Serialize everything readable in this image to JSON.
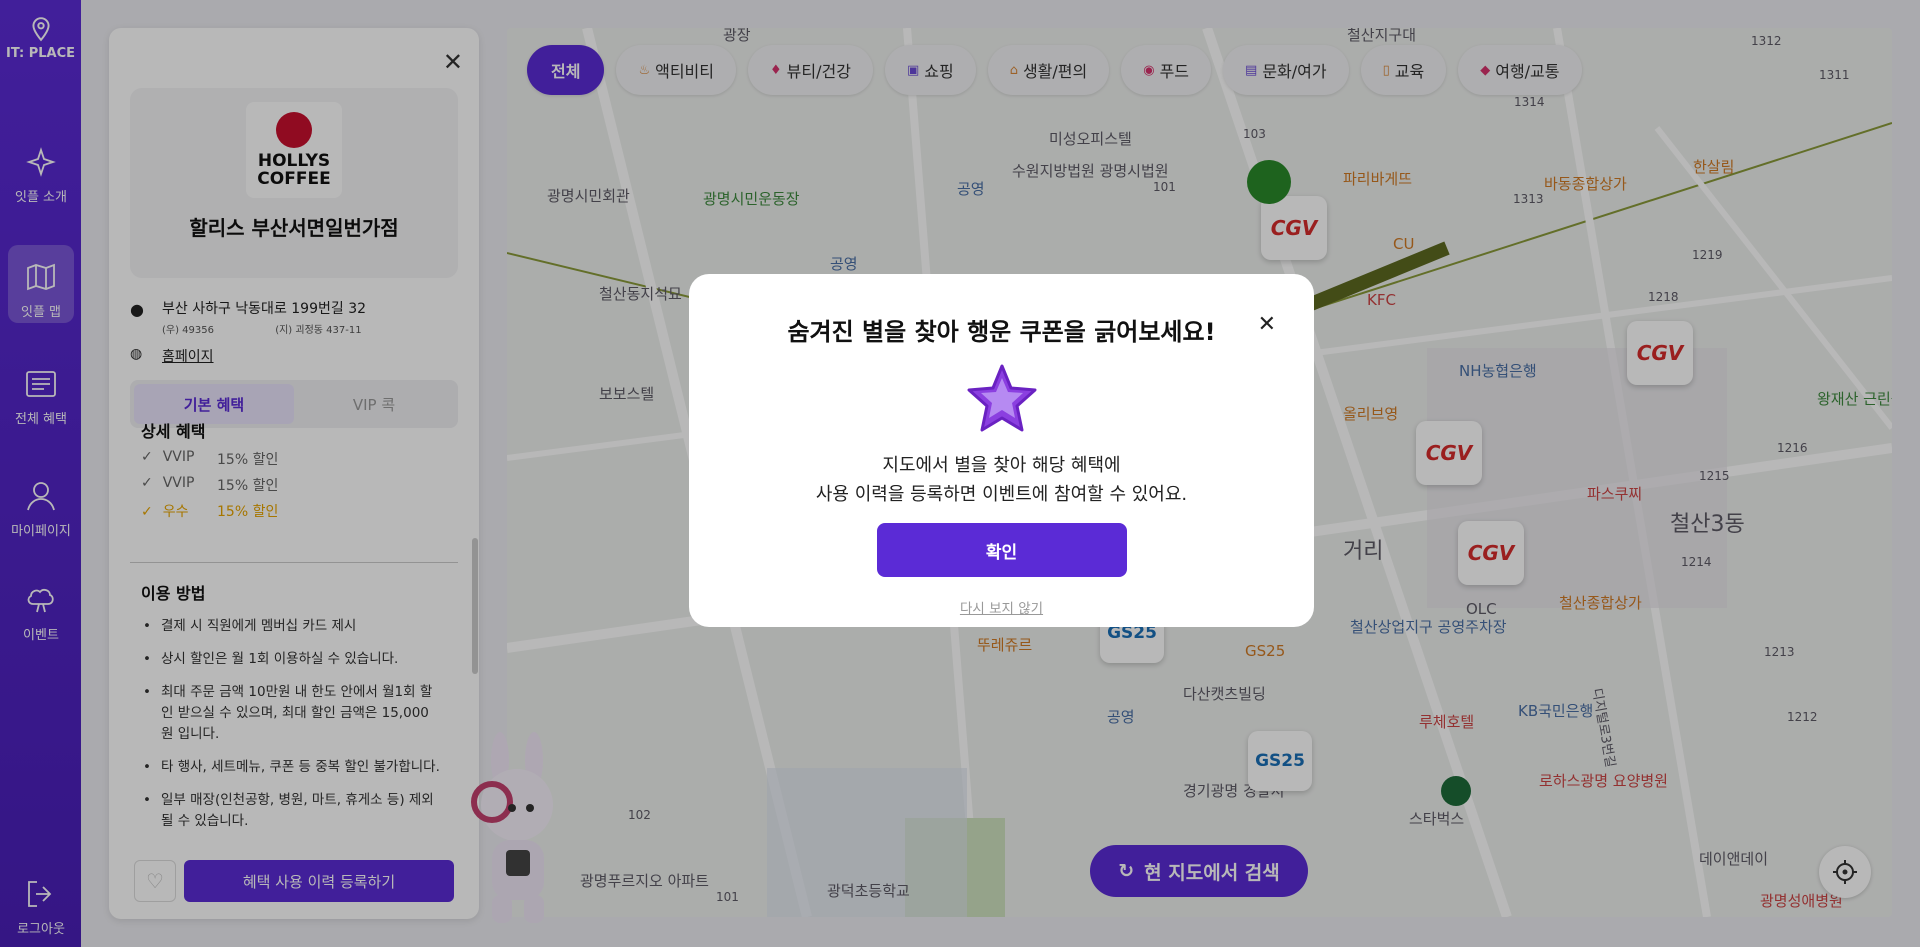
{
  "nav": {
    "brand": "IT: PLACE",
    "items": [
      {
        "label": "잇플 소개",
        "icon": "sparkle-icon"
      },
      {
        "label": "잇플 맵",
        "icon": "map-icon"
      },
      {
        "label": "전체 혜택",
        "icon": "list-icon"
      },
      {
        "label": "마이페이지",
        "icon": "user-icon"
      },
      {
        "label": "이벤트",
        "icon": "gift-icon"
      }
    ],
    "logout": "로그아웃"
  },
  "filters": [
    "전체",
    "액티비티",
    "뷰티/건강",
    "쇼핑",
    "생활/편의",
    "푸드",
    "문화/여가",
    "교육",
    "여행/교통"
  ],
  "store": {
    "logo_text_1": "HOLLYS",
    "logo_text_2": "COFFEE",
    "name": "할리스 부산서면일번가점",
    "address": "부산 사하구 낙동대로 199번길 32",
    "postal": "(우) 49356",
    "lot_address": "(지) 괴정동 437-11",
    "homepage": "홈페이지",
    "tabs": [
      "기본 혜택",
      "VIP 콕"
    ],
    "detail_title": "상세 혜택",
    "benefits": [
      {
        "grade": "VVIP",
        "rate": "15% 할인"
      },
      {
        "grade": "VVIP",
        "rate": "15% 할인"
      },
      {
        "grade": "우수",
        "rate": "15% 할인"
      }
    ],
    "howto_title": "이용 방법",
    "howto": [
      "결제 시 직원에게 멤버십 카드 제시",
      "상시 할인은 월 1회 이용하실 수 있습니다.",
      "최대 주문 금액 10만원 내 한도 안에서 월1회 할인 받으실 수 있으며, 최대 할인 금액은 15,000원 입니다.",
      "타 행사, 세트메뉴, 쿠폰 등 중복 할인 불가합니다.",
      "일부 매장(인천공항, 병원, 마트, 휴게소 등) 제외될 수 있습니다."
    ],
    "register_button": "혜택 사용 이력 등록하기"
  },
  "map": {
    "search_button": "현 지도에서 검색",
    "labels": {
      "p1": "광명시민회관",
      "p2": "광명시민운동장",
      "p3": "미성오피스텔",
      "p4": "수원지방법원 광명시법원",
      "p5": "철산동지석묘",
      "p6": "보보스텔",
      "p7": "파리바게뜨",
      "p8": "바동종합상가",
      "p9": "한살림",
      "p10": "CU",
      "p11": "KFC",
      "p12": "NH농협은행",
      "p13": "올리브영",
      "p14": "왕재산 근린공원",
      "p15": "파스쿠찌",
      "p16": "철산3동",
      "p17": "철산종합상가",
      "p18": "뚜레쥬르",
      "p19": "GS25",
      "p20": "철산상업지구 공영주차장",
      "p21": "다산캣츠빌딩",
      "p22": "루체호텔",
      "p23": "KB국민은행",
      "p24": "경기광명 경찰서",
      "p25": "스타벅스",
      "p26": "로하스광명 요양병원",
      "p27": "광명푸르지오 아파트",
      "p28": "광덕초등학교",
      "p29": "데이앤데이",
      "p30": "광명성애병원",
      "p31": "OLC",
      "p32": "공영",
      "p33": "거리",
      "p34": "1312",
      "p35": "1311",
      "p36": "1314",
      "p37": "1313",
      "p38": "1219",
      "p39": "1218",
      "p40": "1216",
      "p41": "1215",
      "p42": "1214",
      "p43": "1213",
      "p44": "1212",
      "p45": "103",
      "p46": "101",
      "p47": "102",
      "p48": "101",
      "p49": "철산지구대",
      "p50": "광장",
      "p51": "디지털로3번길",
      "p52": "공영",
      "p53": "공영"
    },
    "cgv": "CGV",
    "gs": "GS25"
  },
  "modal": {
    "title": "숨겨진 별을 찾아 행운 쿠폰을 긁어보세요!",
    "desc_1": "지도에서 별을 찾아 해당 혜택에",
    "desc_2": "사용 이력을 등록하면 이벤트에 참여할 수 있어요.",
    "confirm": "확인",
    "dont_show": "다시 보지 않기"
  }
}
